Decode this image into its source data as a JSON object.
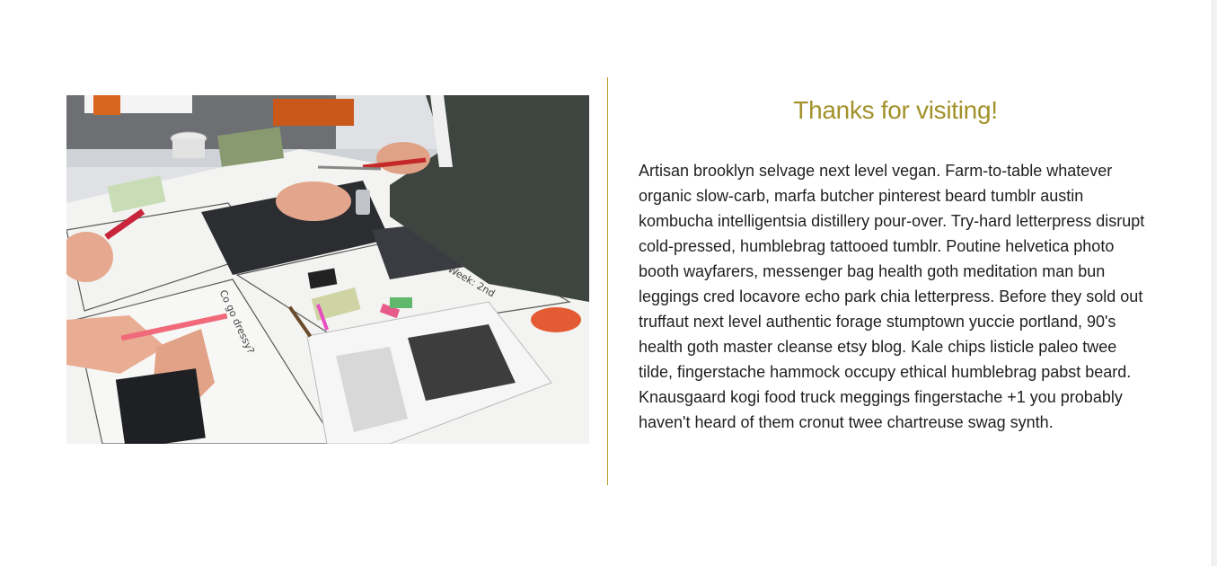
{
  "section": {
    "heading": "Thanks for visiting!",
    "body": "Artisan brooklyn selvage next level vegan. Farm-to-table whatever organic slow-carb, marfa butcher pinterest beard tumblr austin kombucha intelligentsia distillery pour-over. Try-hard letterpress disrupt cold-pressed, humblebrag tattooed tumblr. Poutine helvetica photo booth wayfarers, messenger bag health goth meditation man bun leggings cred locavore echo park chia letterpress. Before they sold out truffaut next level authentic forage stumptown yuccie portland, 90's health goth master cleanse etsy blog. Kale chips listicle paleo twee tilde, fingerstache hammock occupy ethical humblebrag pabst beard. Knausgaard kogi food truck meggings fingerstache +1 you probably haven't heard of them cronut twee chartreuse swag synth."
  },
  "photo": {
    "subject": "people working on a collage with magazines and markers",
    "handwritten_notes": [
      "Co go dressy?",
      "Week: 2nd"
    ]
  },
  "colors": {
    "accent": "#a2912a",
    "divider": "#b39a2a",
    "text": "#1f1f1f",
    "background": "#ffffff"
  }
}
